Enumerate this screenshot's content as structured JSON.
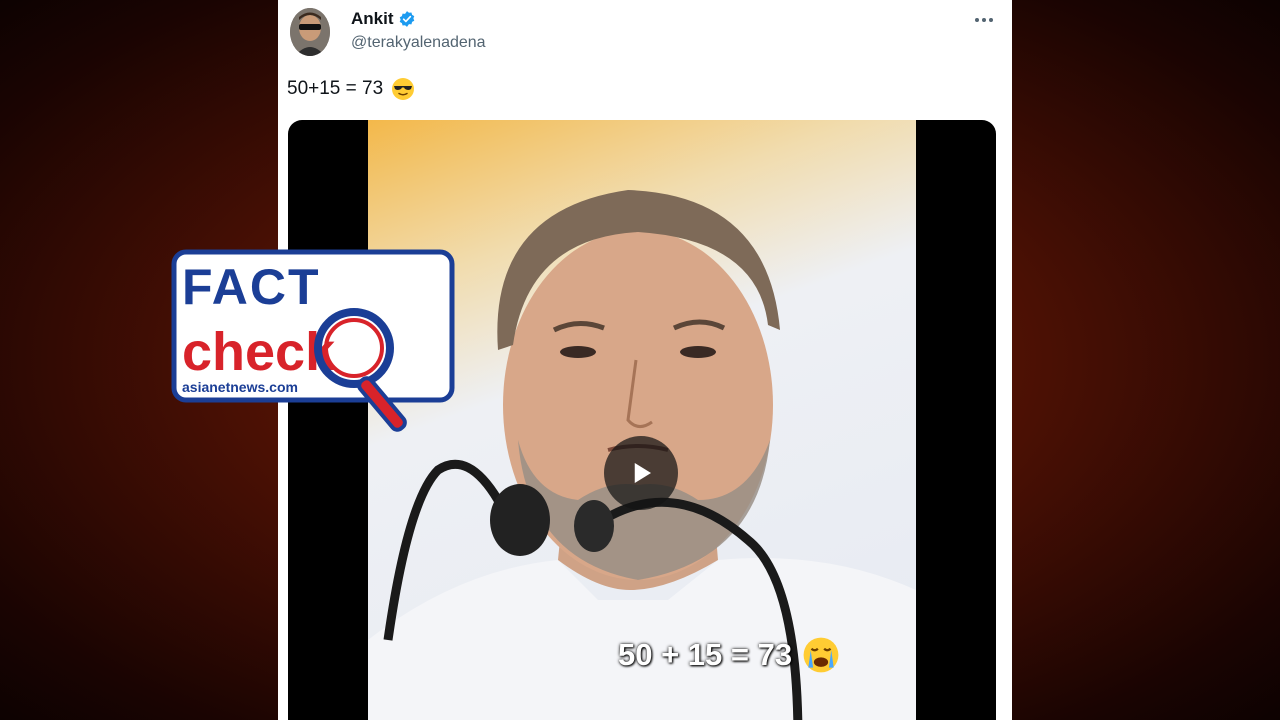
{
  "tweet": {
    "display_name": "Ankit",
    "handle": "@terakyalenadena",
    "text": "50+15 = 73",
    "text_emoji_icon": "cool-sunglasses-emoji-icon"
  },
  "video": {
    "caption": "50 + 15 = 73",
    "caption_emoji_icon": "crying-face-emoji-icon",
    "play_icon": "play-icon"
  },
  "overlay": {
    "fact": "FACT",
    "check": "check",
    "source": "asianetnews.com"
  },
  "colors": {
    "brand_blue": "#1b3e96",
    "brand_red": "#d8232a",
    "verified_blue": "#1d9bf0"
  }
}
